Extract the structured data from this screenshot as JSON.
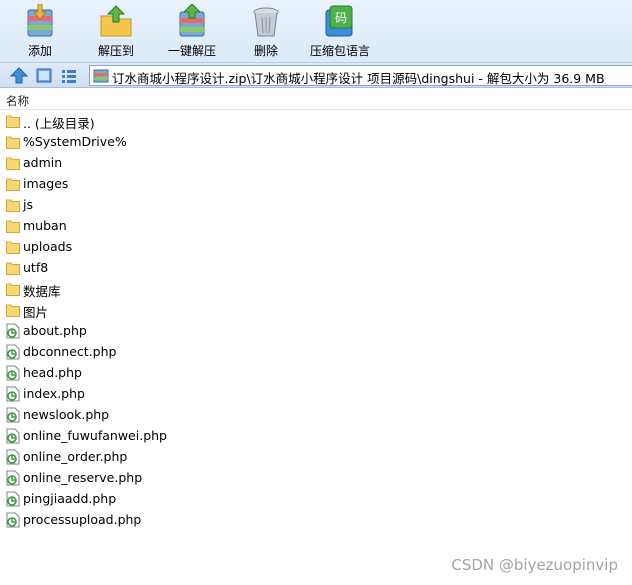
{
  "toolbar": {
    "buttons": [
      {
        "label": "添加",
        "icon": "add-archive-icon"
      },
      {
        "label": "解压到",
        "icon": "extract-to-icon"
      },
      {
        "label": "一键解压",
        "icon": "one-click-extract-icon"
      },
      {
        "label": "删除",
        "icon": "delete-trash-icon"
      },
      {
        "label": "压缩包语言",
        "icon": "archive-language-icon",
        "badge": "码"
      }
    ]
  },
  "address": {
    "path": "订水商城小程序设计.zip\\订水商城小程序设计 项目源码\\dingshui - 解包大小为 36.9 MB"
  },
  "columns": {
    "name": "名称"
  },
  "files": [
    {
      "name": ".. (上级目录)",
      "type": "folder"
    },
    {
      "name": "%SystemDrive%",
      "type": "folder"
    },
    {
      "name": "admin",
      "type": "folder"
    },
    {
      "name": "images",
      "type": "folder"
    },
    {
      "name": "js",
      "type": "folder"
    },
    {
      "name": "muban",
      "type": "folder"
    },
    {
      "name": "uploads",
      "type": "folder"
    },
    {
      "name": "utf8",
      "type": "folder"
    },
    {
      "name": "数据库",
      "type": "folder"
    },
    {
      "name": "图片",
      "type": "folder"
    },
    {
      "name": "about.php",
      "type": "php"
    },
    {
      "name": "dbconnect.php",
      "type": "php"
    },
    {
      "name": "head.php",
      "type": "php"
    },
    {
      "name": "index.php",
      "type": "php"
    },
    {
      "name": "newslook.php",
      "type": "php"
    },
    {
      "name": "online_fuwufanwei.php",
      "type": "php"
    },
    {
      "name": "online_order.php",
      "type": "php"
    },
    {
      "name": "online_reserve.php",
      "type": "php"
    },
    {
      "name": "pingjiaadd.php",
      "type": "php"
    },
    {
      "name": "processupload.php",
      "type": "php"
    }
  ],
  "watermark": "CSDN @biyezuopinvip",
  "colors": {
    "folder": "#f7d774",
    "php_icon": "#3a9a3a",
    "toolbar_bg": "#e3eefb"
  }
}
